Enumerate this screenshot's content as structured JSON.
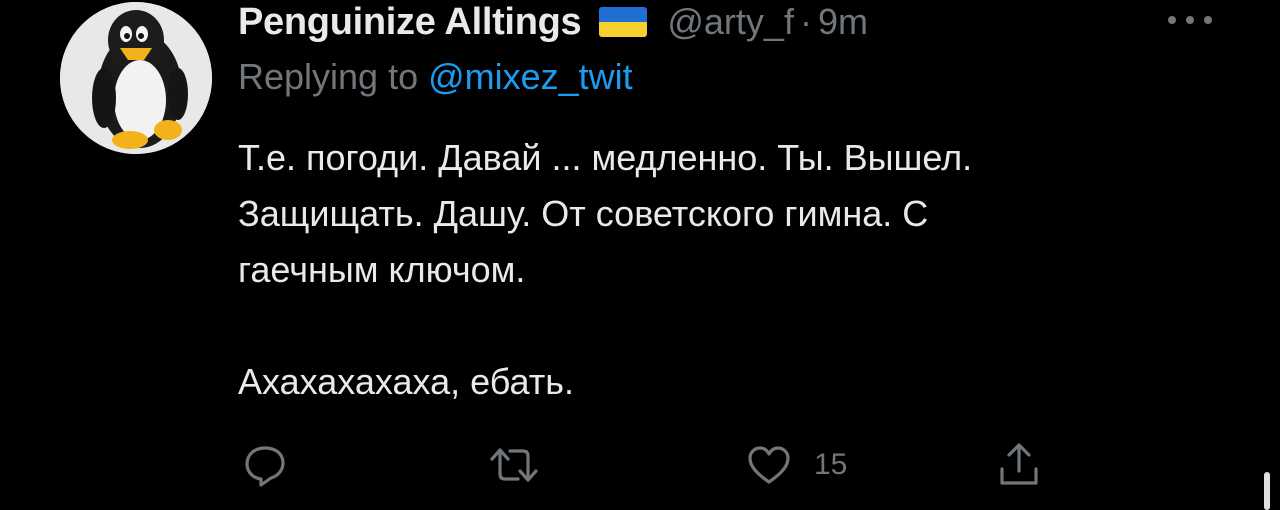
{
  "tweet": {
    "display_name": "Penguinize Alltings",
    "flag": "ukraine-flag",
    "handle": "@arty_f",
    "separator": "·",
    "time": "9m",
    "replying_prefix": "Replying to ",
    "replying_to": "@mixez_twit",
    "body_lines": [
      "Т.е. погоди. Давай ... медленно. Ты. Вышел.",
      "Защищать. Дашу. От советского гимна. С",
      "гаечным ключом."
    ],
    "body_last": "Ахахахахаха, ебать.",
    "likes": "15"
  },
  "icons": {
    "reply": "reply-icon",
    "retweet": "retweet-icon",
    "like": "heart-icon",
    "share": "share-icon",
    "more": "more-icon"
  },
  "colors": {
    "background": "#000000",
    "text": "#e7e9ea",
    "secondary": "#71767b",
    "link": "#1d9bf0",
    "flag_blue": "#1f6fd4",
    "flag_yellow": "#f6d12e"
  }
}
